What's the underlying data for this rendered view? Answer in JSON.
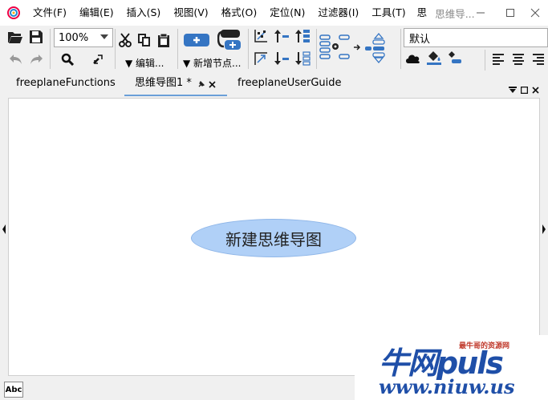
{
  "menubar": {
    "items": [
      "文件(F)",
      "编辑(E)",
      "插入(S)",
      "视图(V)",
      "格式(O)",
      "定位(N)",
      "过滤器(I)",
      "工具(T)",
      "思"
    ],
    "window_title": "思维导..."
  },
  "toolbar": {
    "zoom_value": "100%",
    "edit_dropdown_label": "▼ 编辑...",
    "new_node_dropdown_label": "▼ 新增节点...",
    "style_value": "默认"
  },
  "tabs": [
    {
      "label": "freeplaneFunctions",
      "active": false
    },
    {
      "label": "思维导图1 *",
      "active": true
    },
    {
      "label": "freeplaneUserGuide",
      "active": false
    }
  ],
  "mindmap": {
    "root_node_text": "新建思维导图",
    "root_fill": "#b0d0f7"
  },
  "statusbar": {
    "spell_label": "Abc"
  },
  "watermark": {
    "big_text": "牛网puls",
    "small_text": "最牛哥的资源网",
    "url_text": "www.niuw.us"
  },
  "colors": {
    "accent": "#4a7fc1",
    "tab_underline": "#6a9fd8"
  }
}
